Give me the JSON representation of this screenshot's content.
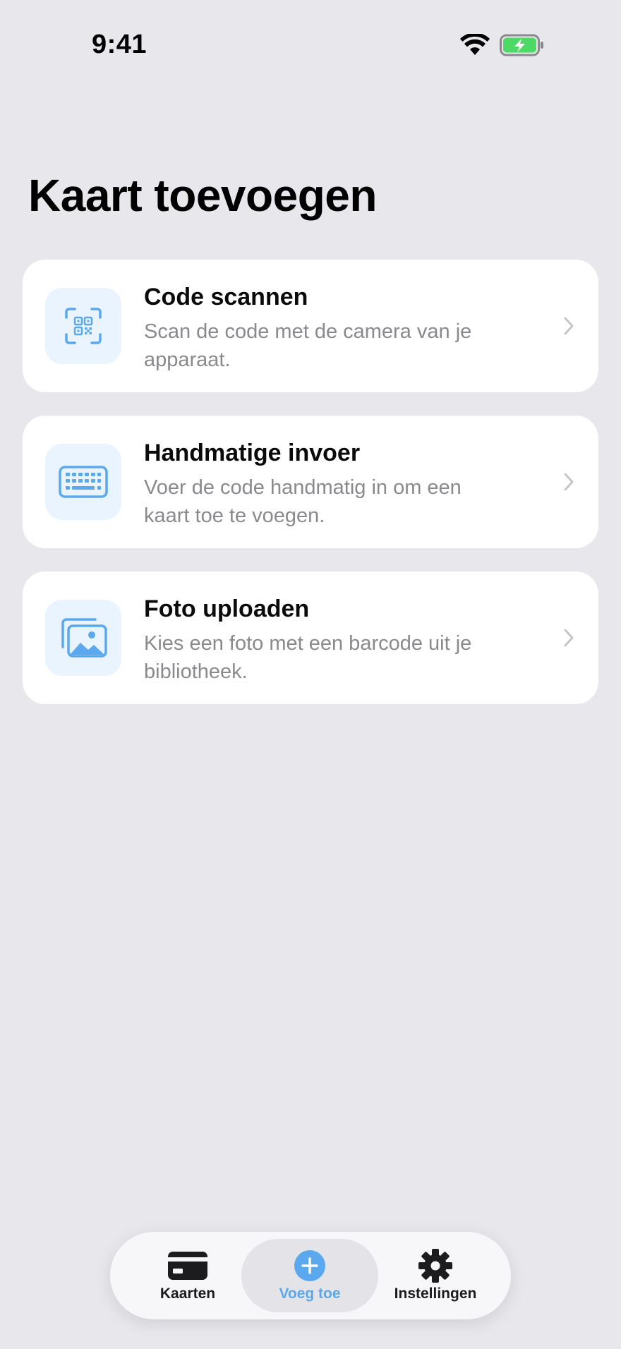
{
  "status_bar": {
    "time": "9:41",
    "icons": [
      "wifi-icon",
      "battery-charging-icon"
    ]
  },
  "page": {
    "title": "Kaart toevoegen"
  },
  "options": [
    {
      "title": "Code scannen",
      "description": "Scan de code met de camera van je apparaat.",
      "icon": "qr-scan-icon"
    },
    {
      "title": "Handmatige invoer",
      "description": "Voer de code handmatig in om een kaart toe te voegen.",
      "icon": "keyboard-icon"
    },
    {
      "title": "Foto uploaden",
      "description": "Kies een foto met een barcode uit je bibliotheek.",
      "icon": "photo-library-icon"
    }
  ],
  "tab_bar": {
    "active": "Voeg toe",
    "tabs": [
      {
        "label": "Kaarten",
        "icon": "card-icon"
      },
      {
        "label": "Voeg toe",
        "icon": "plus-circle-icon"
      },
      {
        "label": "Instellingen",
        "icon": "gear-icon"
      }
    ]
  },
  "colors": {
    "background": "#e8e7ec",
    "card": "#ffffff",
    "accent": "#5aa9ee",
    "icon_tile": "#eaf4ff",
    "secondary_text": "#8a8a8e",
    "battery": "#4cd964"
  }
}
